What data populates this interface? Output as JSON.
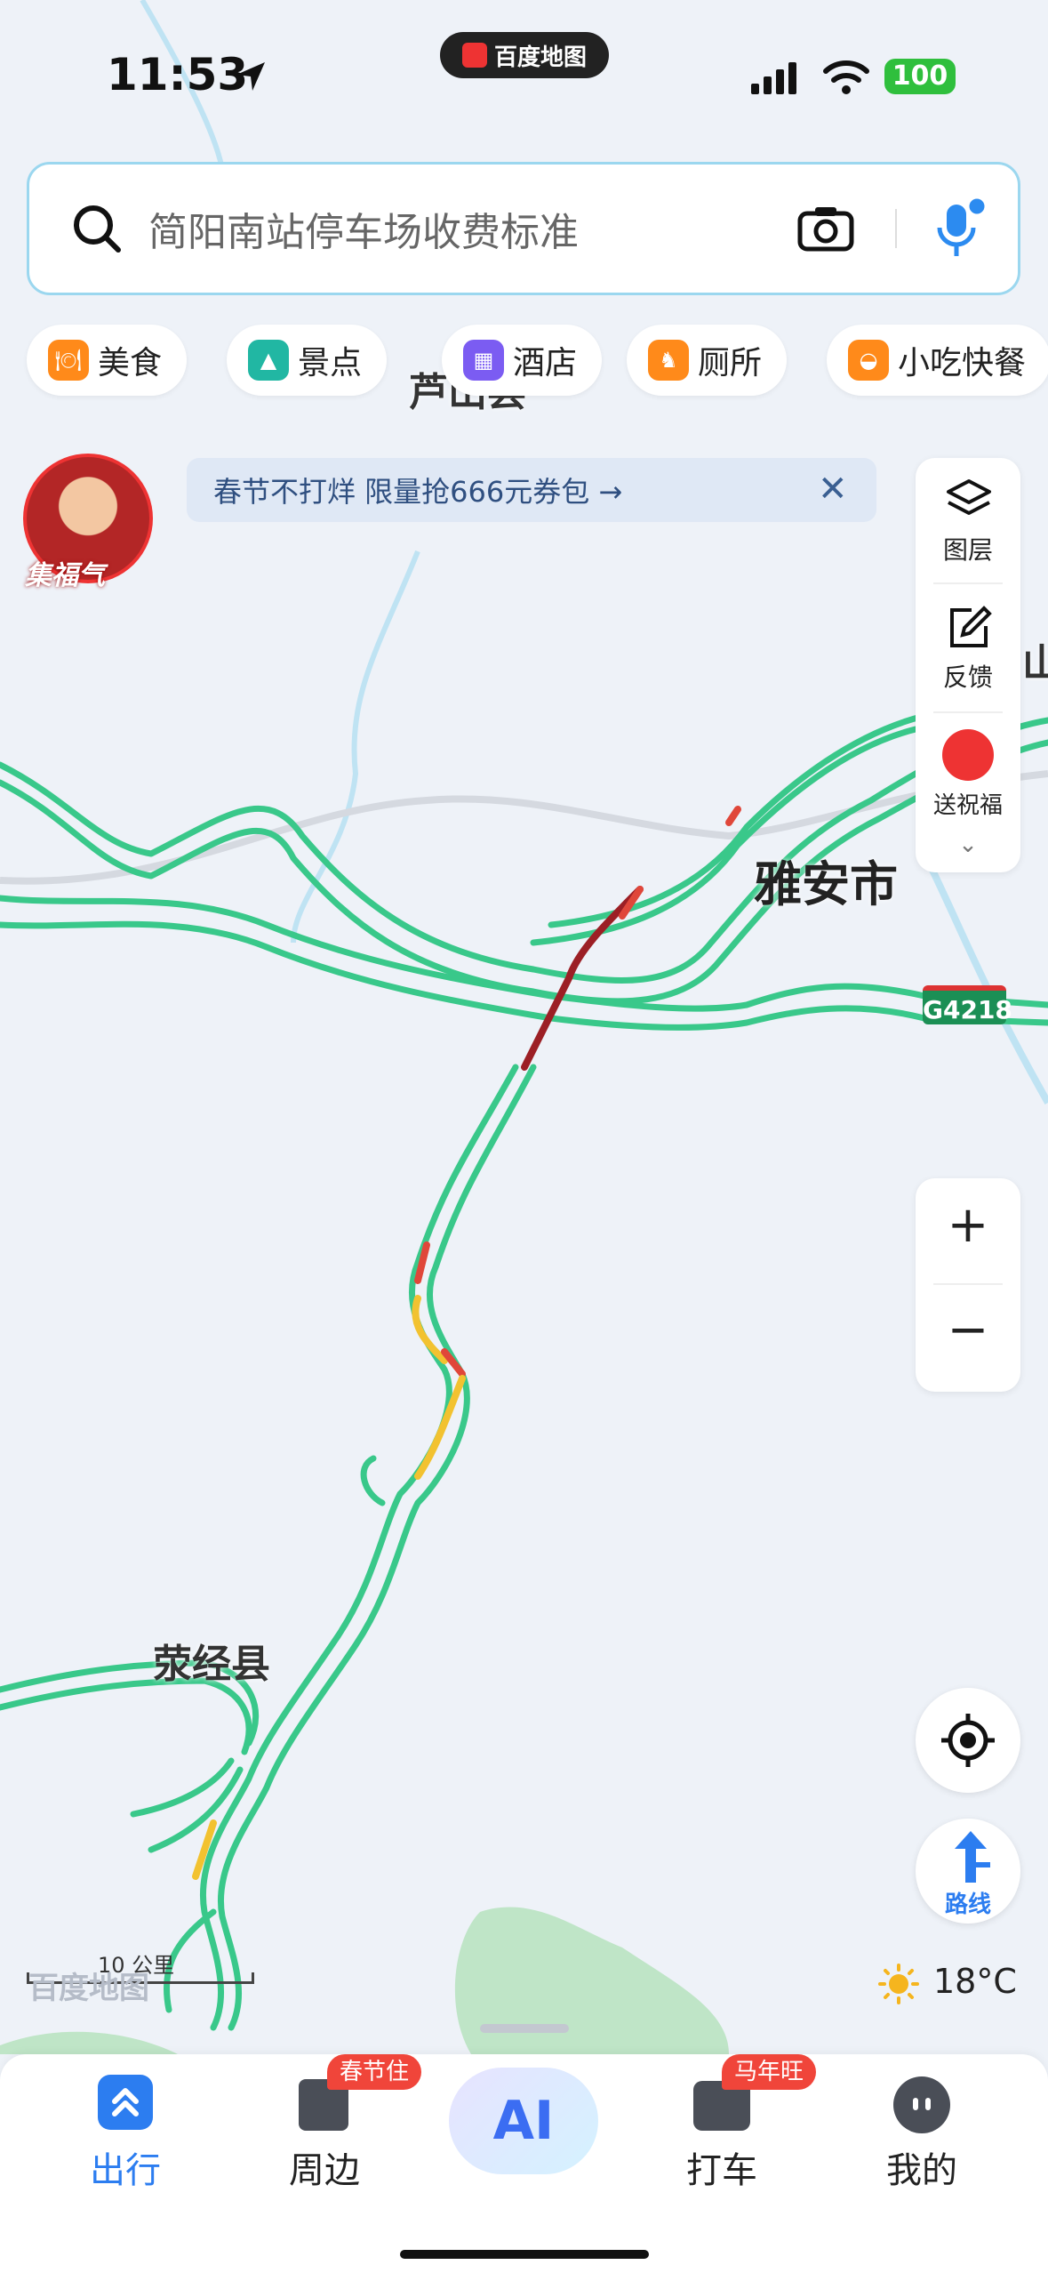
{
  "status_bar": {
    "time": "11:53",
    "app_name": "百度地图",
    "battery": "100"
  },
  "search": {
    "placeholder": "简阳南站停车场收费标准"
  },
  "categories": [
    {
      "label": "美食",
      "color": "#ff8a1a"
    },
    {
      "label": "景点",
      "color": "#21b7a3"
    },
    {
      "label": "酒店",
      "color": "#7b5cf2"
    },
    {
      "label": "厕所",
      "color": "#ff8a1a"
    },
    {
      "label": "小吃快餐",
      "color": "#ff8a1a"
    }
  ],
  "promo": {
    "avatar_label": "集福气",
    "banner_text": "春节不打烊 限量抢666元券包 →"
  },
  "side_panel": {
    "layers_label": "图层",
    "feedback_label": "反馈",
    "blessing_label": "送祝福"
  },
  "map": {
    "top_label": "芦山县",
    "city_label": "雅安市",
    "county_label": "荥经县",
    "edge_label": "山",
    "highway_shield": "G4218",
    "scale_text": "10 公里",
    "watermark": "百度地图",
    "traffic_colors": {
      "smooth": "#39c88a",
      "slow": "#f2c230",
      "jam": "#e0473a",
      "heavy": "#9c1f25"
    }
  },
  "weather": {
    "temperature": "18°C"
  },
  "zoom": {
    "plus": "+",
    "minus": "−"
  },
  "route_button": {
    "label": "路线"
  },
  "bottom_nav": {
    "travel": "出行",
    "nearby": "周边",
    "nearby_badge": "春节住",
    "ai": "AI",
    "taxi": "打车",
    "taxi_badge": "马年旺",
    "mine": "我的"
  }
}
